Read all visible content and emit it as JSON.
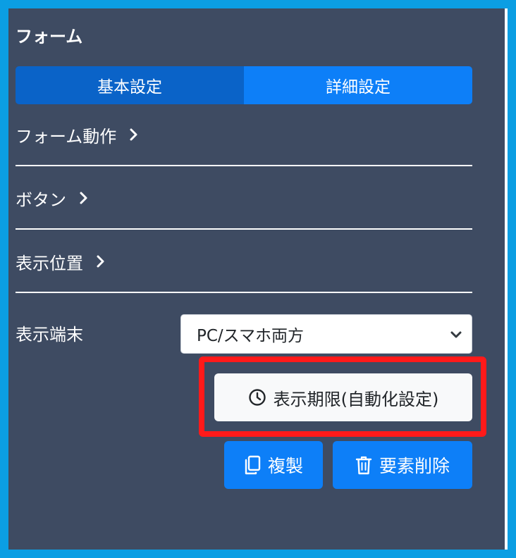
{
  "panel": {
    "title": "フォーム",
    "tabs": [
      {
        "label": "基本設定",
        "active": true
      },
      {
        "label": "詳細設定",
        "active": false
      }
    ],
    "sections": [
      {
        "label": "フォーム動作"
      },
      {
        "label": "ボタン"
      },
      {
        "label": "表示位置"
      }
    ],
    "device": {
      "label": "表示端末",
      "selected": "PC/スマホ両方"
    },
    "buttons": {
      "expiry": "表示期限(自動化設定)",
      "duplicate": "複製",
      "delete": "要素削除"
    }
  },
  "colors": {
    "panel_bg": "#3e4b62",
    "outer_border": "#0b9ee3",
    "primary": "#0d7ff8",
    "active_tab": "#0a63c8",
    "highlight": "#ff1a1a"
  },
  "icons": [
    "chevron-right-icon",
    "chevron-down-icon",
    "clock-icon",
    "copy-icon",
    "trash-icon"
  ]
}
